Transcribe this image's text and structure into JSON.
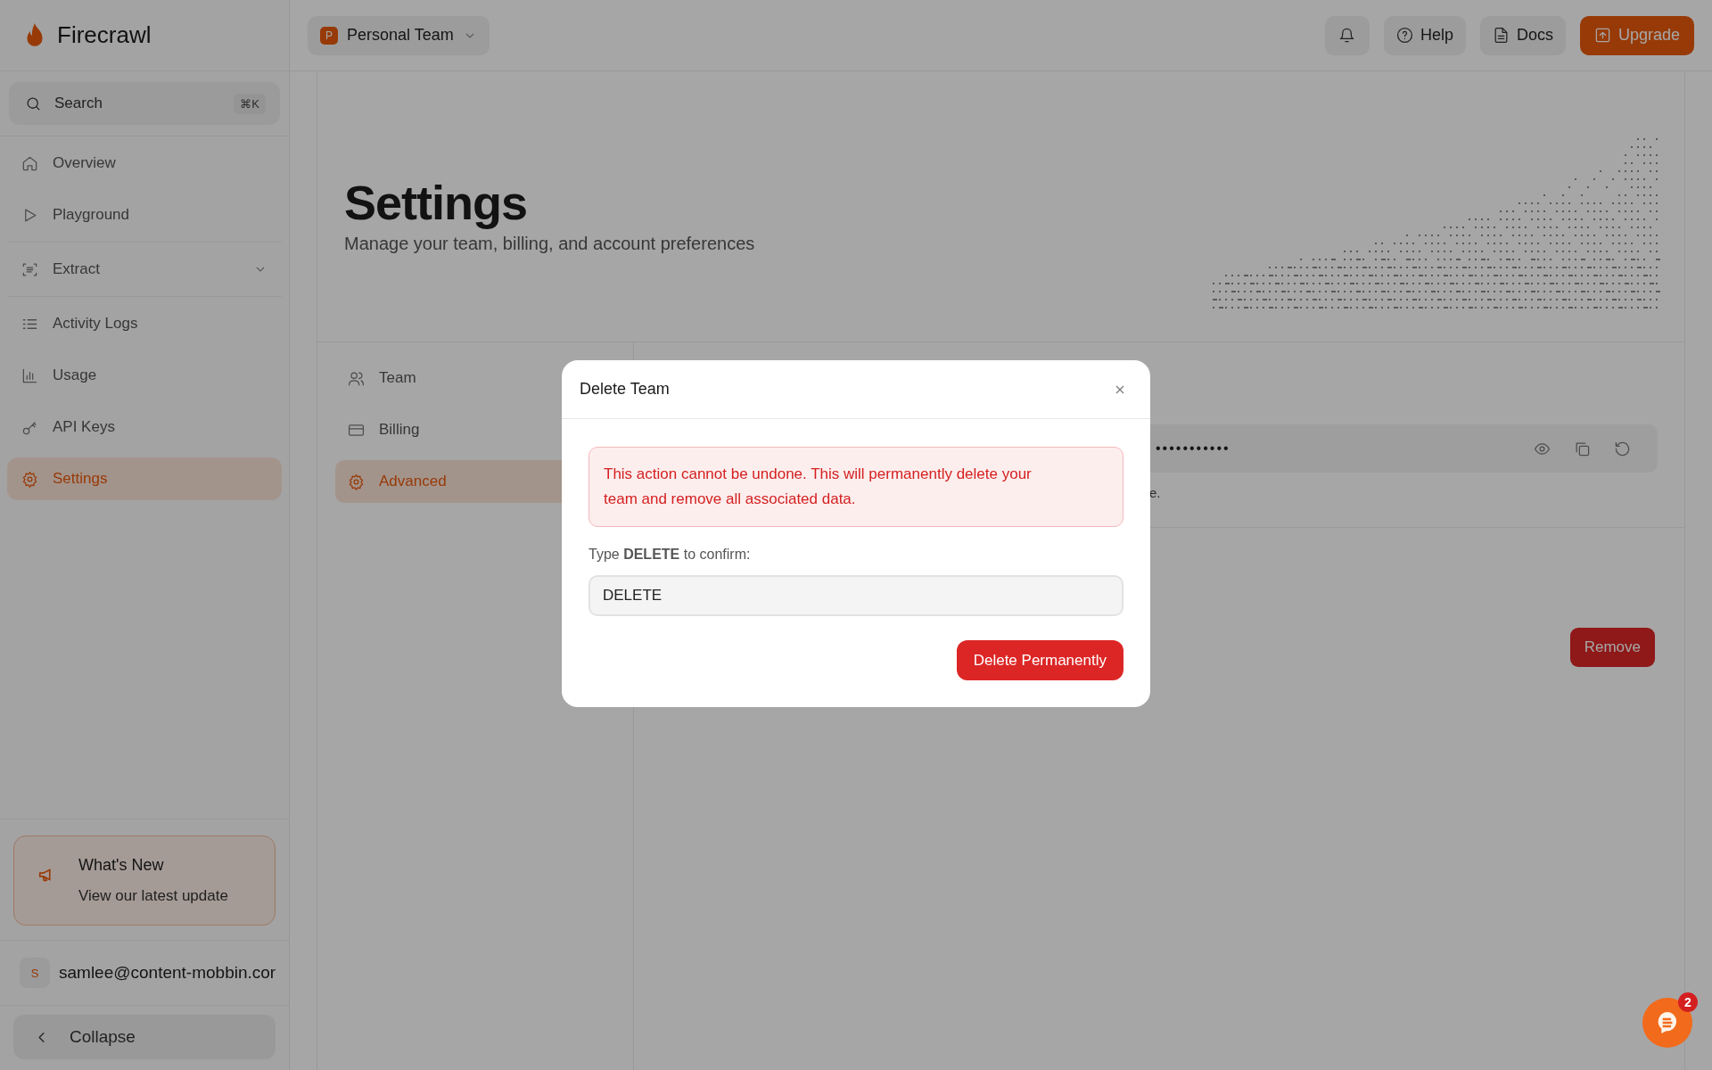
{
  "brand": {
    "name": "Firecrawl"
  },
  "search": {
    "placeholder": "Search",
    "shortcut": "⌘K"
  },
  "nav_groups": [
    [
      {
        "label": "Overview",
        "kind": "link",
        "selected": false
      },
      {
        "label": "Playground",
        "kind": "link",
        "selected": false
      }
    ],
    [
      {
        "label": "Extract",
        "kind": "dropdown",
        "selected": false
      }
    ],
    [
      {
        "label": "Activity Logs",
        "kind": "link",
        "selected": false
      },
      {
        "label": "Usage",
        "kind": "link",
        "selected": false
      },
      {
        "label": "API Keys",
        "kind": "link",
        "selected": false
      },
      {
        "label": "Settings",
        "kind": "link",
        "selected": true
      }
    ]
  ],
  "whats_new": {
    "title": "What's New",
    "text": "View our latest update"
  },
  "user": {
    "initial": "S",
    "email": "samlee@content-mobbin.cor"
  },
  "collapse": {
    "label": "Collapse"
  },
  "team_selector": {
    "initial": "P",
    "name": "Personal Team"
  },
  "header_buttons": [
    {
      "kind": "icon"
    },
    {
      "kind": "default",
      "label": "Help"
    },
    {
      "kind": "default",
      "label": "Docs"
    },
    {
      "kind": "primary",
      "label": "Upgrade"
    }
  ],
  "page": {
    "title": "Settings",
    "subtitle": "Manage your team, billing, and account preferences"
  },
  "settings_nav": [
    {
      "label": "Team",
      "selected": false
    },
    {
      "label": "Billing",
      "selected": false
    },
    {
      "label": "Advanced",
      "selected": true
    }
  ],
  "api_key": {
    "value": "•••••••••••",
    "note": "e."
  },
  "remove_button": {
    "label": "Remove"
  },
  "modal": {
    "title": "Delete Team",
    "warning": "This action cannot be undone. This will permanently delete your team and remove all associated data.",
    "confirm_label": "Type **DELETE** to confirm:",
    "input_value": "DELETE",
    "submit": "Delete Permanently"
  },
  "chat": {
    "badge": "2"
  }
}
